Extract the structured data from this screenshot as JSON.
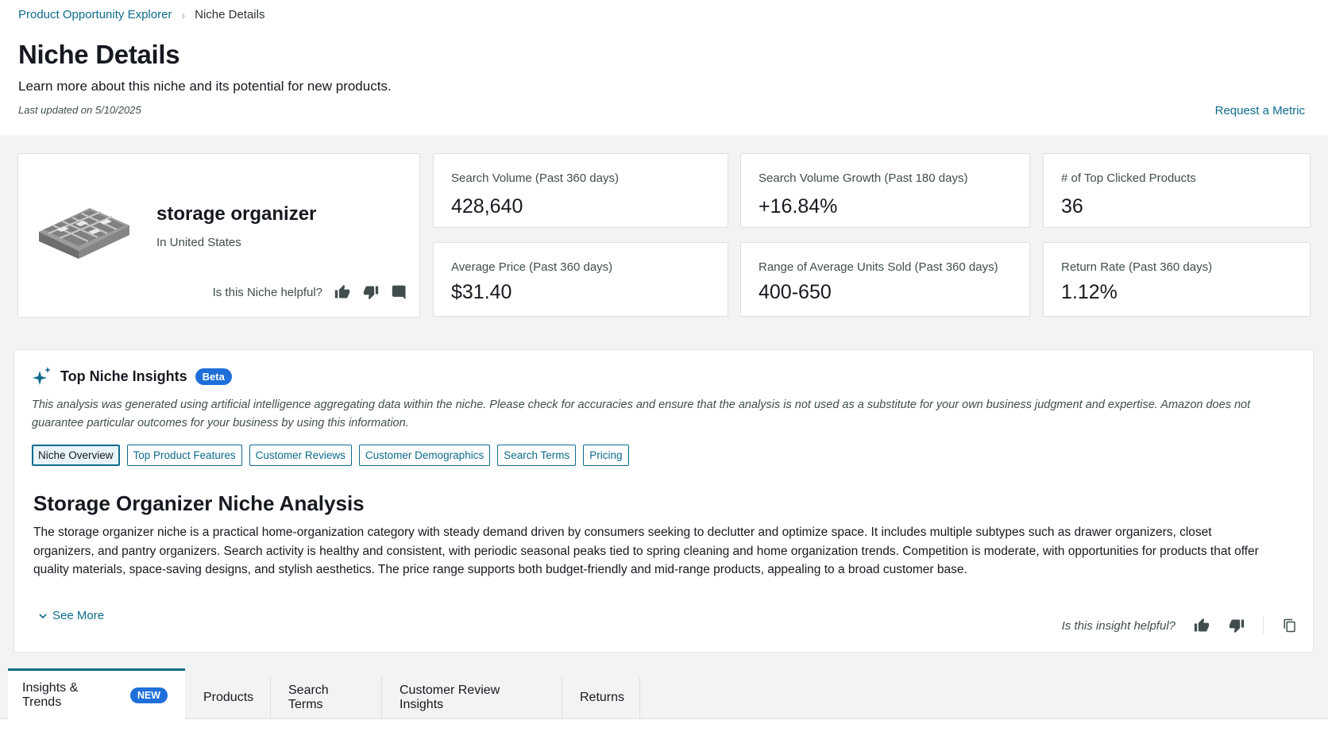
{
  "breadcrumb": {
    "root": "Product Opportunity Explorer",
    "separator": "›",
    "current": "Niche Details"
  },
  "header": {
    "title": "Niche Details",
    "subtitle": "Learn more about this niche and its potential for new products.",
    "last_updated": "Last updated on 5/10/2025",
    "request_metric": "Request a Metric"
  },
  "niche": {
    "name": "storage organizer",
    "country": "In United States",
    "helpful_prompt": "Is this Niche helpful?"
  },
  "metrics": [
    {
      "label": "Search Volume (Past 360 days)",
      "value": "428,640"
    },
    {
      "label": "Search Volume Growth (Past 180 days)",
      "value": "+16.84%"
    },
    {
      "label": "# of Top Clicked Products",
      "value": "36"
    },
    {
      "label": "Average Price (Past 360 days)",
      "value": "$31.40"
    },
    {
      "label": "Range of Average Units Sold (Past 360 days)",
      "value": "400-650"
    },
    {
      "label": "Return Rate (Past 360 days)",
      "value": "1.12%"
    }
  ],
  "insights": {
    "title": "Top Niche Insights",
    "badge": "Beta",
    "disclaimer": "This analysis was generated using artificial intelligence aggregating data within the niche. Please check for accuracies and ensure that the analysis is not used as a substitute for your own business judgment and expertise. Amazon does not guarantee particular outcomes for your business by using this information.",
    "tabs": [
      {
        "label": "Niche Overview",
        "active": true
      },
      {
        "label": "Top Product Features",
        "active": false
      },
      {
        "label": "Customer Reviews",
        "active": false
      },
      {
        "label": "Customer Demographics",
        "active": false
      },
      {
        "label": "Search Terms",
        "active": false
      },
      {
        "label": "Pricing",
        "active": false
      }
    ],
    "analysis_title": "Storage Organizer Niche  Analysis",
    "analysis_body": "The storage organizer niche is a practical home-organization category with steady demand driven by consumers seeking to declutter and optimize space. It includes multiple subtypes such as drawer organizers, closet organizers, and pantry organizers. Search activity is healthy and consistent, with periodic seasonal peaks tied to spring cleaning and home organization trends. Competition is moderate, with opportunities for products that offer quality materials, space-saving designs, and stylish aesthetics. The price range supports both budget-friendly and mid-range products, appealing to a broad customer base.",
    "see_more": "See More",
    "helpful_prompt": "Is this insight helpful?"
  },
  "bottom_tabs": [
    {
      "label": "Insights & Trends",
      "badge": "NEW",
      "active": true
    },
    {
      "label": "Products"
    },
    {
      "label": "Search Terms"
    },
    {
      "label": "Customer Review Insights"
    },
    {
      "label": "Returns"
    }
  ],
  "colors": {
    "link": "#0e6b8c",
    "badge": "#1e6fd9",
    "page_bg": "#f2f3f3"
  }
}
